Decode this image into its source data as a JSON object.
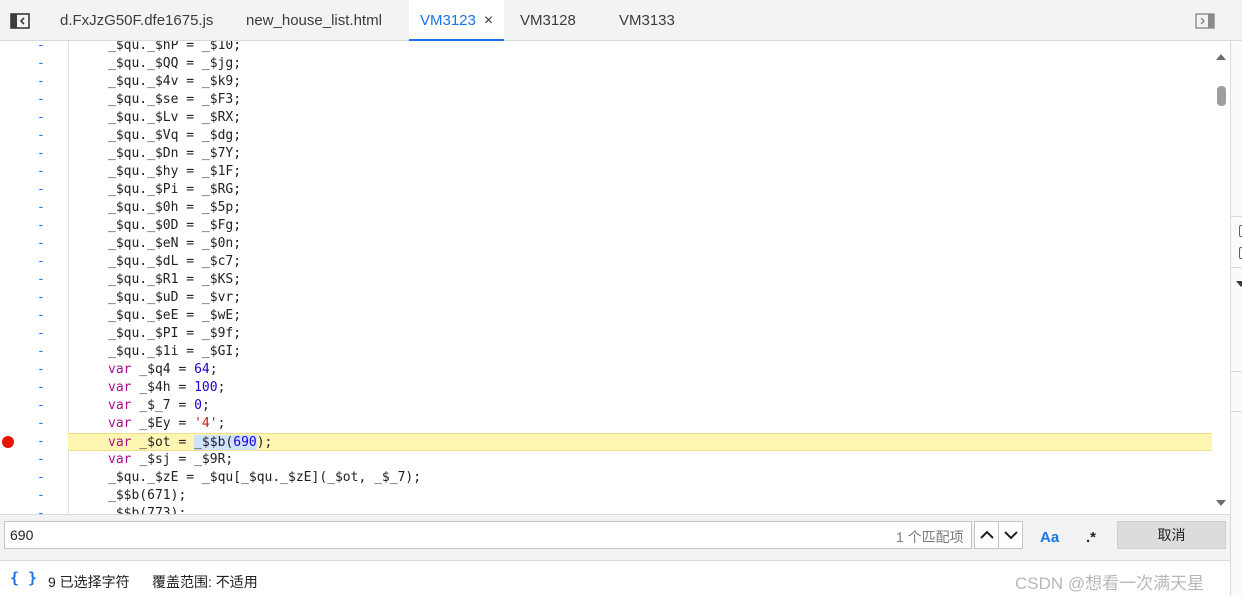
{
  "tabs": [
    {
      "label": "d.FxJzG50F.dfe1675.js",
      "active": false
    },
    {
      "label": "new_house_list.html",
      "active": false
    },
    {
      "label": "VM3123",
      "active": true,
      "close": "×"
    },
    {
      "label": "VM3128",
      "active": false
    },
    {
      "label": "VM3133",
      "active": false
    }
  ],
  "editor": {
    "gutter_marker": "-",
    "lines": [
      {
        "text": "_$qu._$hP = _$10;"
      },
      {
        "text": "_$qu._$QQ = _$jg;"
      },
      {
        "text": "_$qu._$4v = _$k9;"
      },
      {
        "text": "_$qu._$se = _$F3;"
      },
      {
        "text": "_$qu._$Lv = _$RX;"
      },
      {
        "text": "_$qu._$Vq = _$dg;"
      },
      {
        "text": "_$qu._$Dn = _$7Y;"
      },
      {
        "text": "_$qu._$hy = _$1F;"
      },
      {
        "text": "_$qu._$Pi = _$RG;"
      },
      {
        "text": "_$qu._$0h = _$5p;"
      },
      {
        "text": "_$qu._$0D = _$Fg;"
      },
      {
        "text": "_$qu._$eN = _$0n;"
      },
      {
        "text": "_$qu._$dL = _$c7;"
      },
      {
        "text": "_$qu._$R1 = _$KS;"
      },
      {
        "text": "_$qu._$uD = _$vr;"
      },
      {
        "text": "_$qu._$eE = _$wE;"
      },
      {
        "text": "_$qu._$PI = _$9f;"
      },
      {
        "text": "_$qu._$1i = _$GI;"
      },
      {
        "kw": "var",
        "name": "_$q4",
        "op": "=",
        "num": "64",
        "end": ";"
      },
      {
        "kw": "var",
        "name": "_$4h",
        "op": "=",
        "num": "100",
        "end": ";"
      },
      {
        "kw": "var",
        "name": "_$_7",
        "op": "=",
        "num": "0",
        "end": ";"
      },
      {
        "kw": "var",
        "name": "_$Ey",
        "op": "=",
        "str": "'4'",
        "end": ";"
      },
      {
        "kw": "var",
        "name": "_$ot",
        "op": "=",
        "call": "_$$b(",
        "sel": "690",
        "end": ");",
        "breakpoint": true,
        "highlight": true
      },
      {
        "kw": "var",
        "name": "_$sj",
        "op": "=",
        "text2": "_$9R;"
      },
      {
        "text": "_$qu._$zE = _$qu[_$qu._$zE](_$ot, _$_7);"
      },
      {
        "text": "_$$b(671);"
      },
      {
        "text": "_$$b(773);"
      }
    ]
  },
  "search": {
    "value": "690",
    "match_count": "1 个匹配项",
    "case_label": "Aa",
    "regex_label": ".*",
    "cancel_label": "取消"
  },
  "status": {
    "pretty_print": "{ }",
    "selection": "9 已选择字符",
    "coverage": "覆盖范围: 不适用"
  },
  "watermark": "CSDN @想看一次满天星",
  "colors": {
    "accent": "#1a73e8",
    "breakpoint": "#e51400",
    "highlight": "#fff6b3"
  }
}
